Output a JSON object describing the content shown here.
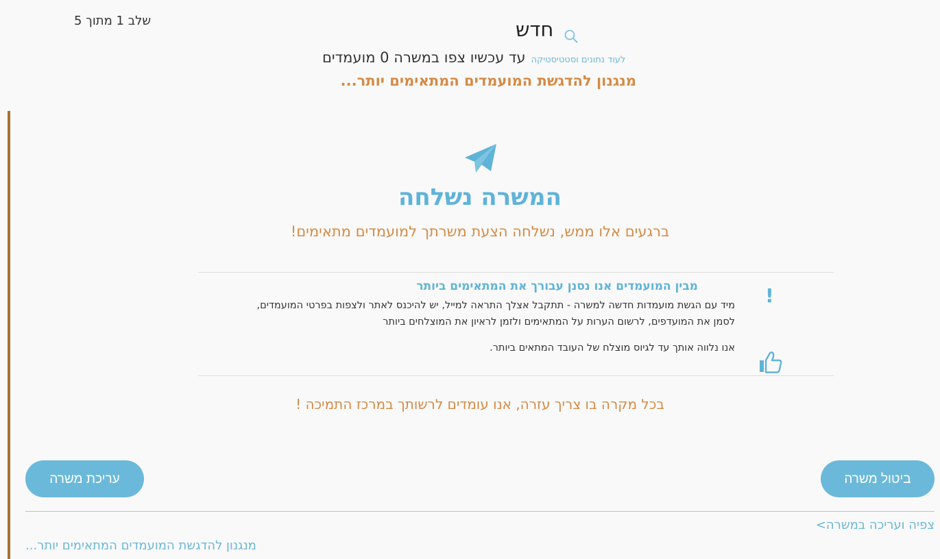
{
  "header": {
    "step_label": "שלב 1 מתוך 5",
    "title": "חדש",
    "viewers_text": "עד עכשיו צפו במשרה 0 מועמדים",
    "stats_link": "לעוד נתונים וסטטיסטיקה",
    "promo_text": "מנגנון להדגשת המועמדים המתאימים יותר..."
  },
  "confirmation": {
    "title": "המשרה נשלחה",
    "subtitle": "ברגעים אלו ממש, נשלחה הצעת משרתך למועמדים מתאימים!"
  },
  "info": {
    "title": "מבין המועמדים אנו נסנן עבורך את המתאימים ביותר",
    "text": "מיד עם הגשת מועמדות חדשה למשרה - תתקבל אצלך התראה למייל, יש להיכנס לאתר ולצפות בפרטי המועמדים, לסמן את המועדפים, לרשום הערות על המתאימים ולזמן לראיון את המוצלחים ביותר",
    "text2": "אנו נלווה אותך עד לגיוס מוצלח של העובד המתאים ביותר."
  },
  "help_text": "בכל מקרה בו צריך עזרה, אנו עומדים לרשותך במרכז התמיכה !",
  "buttons": {
    "edit": "עריכת משרה",
    "cancel": "ביטול משרה"
  },
  "footer": {
    "view_edit_link": "צפיה ועריכה במשרה>",
    "promo_link": "מנגנון להדגשת המועמדים המתאימים יותר..."
  },
  "colors": {
    "accent_blue": "#5fb3d8",
    "accent_orange": "#d58a45",
    "side_bar": "#a8712f"
  },
  "icons": [
    "search-icon",
    "paper-plane-icon",
    "exclamation-icon",
    "thumbs-up-icon"
  ]
}
